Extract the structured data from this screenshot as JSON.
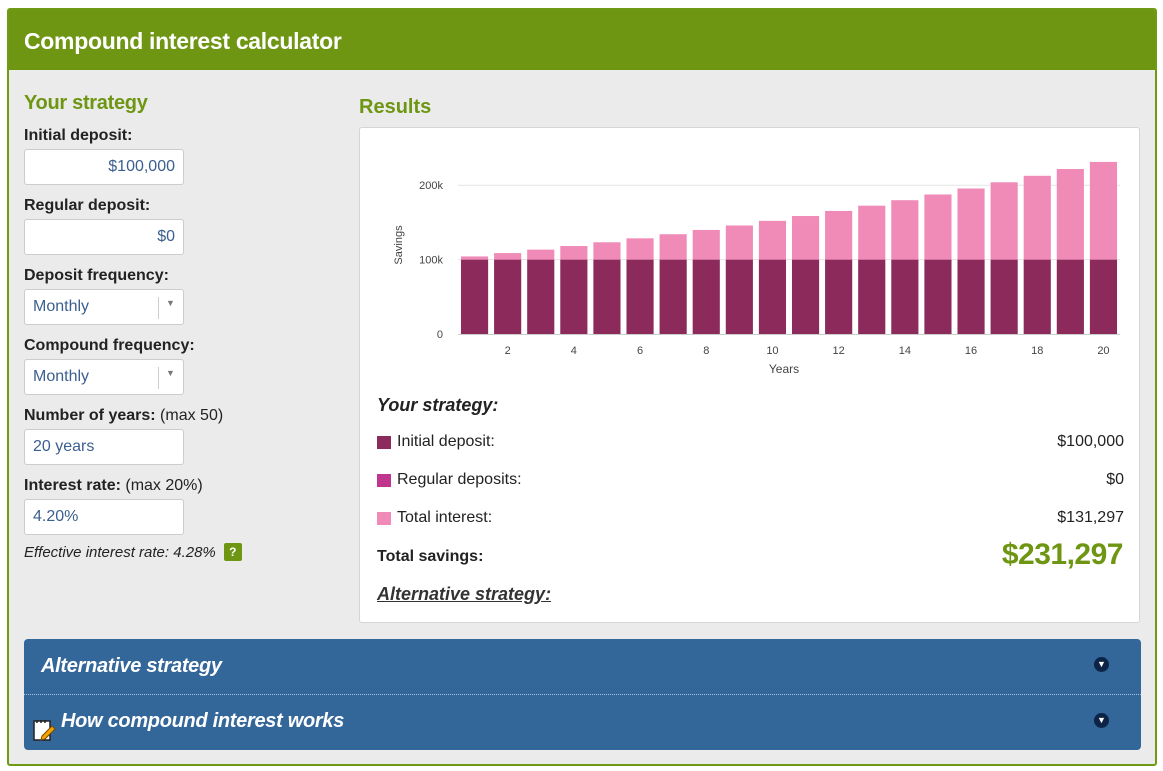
{
  "app": {
    "title": "Compound interest calculator"
  },
  "strategy": {
    "title": "Your strategy",
    "initial_deposit": {
      "label": "Initial deposit:",
      "value": "$100,000"
    },
    "regular_deposit": {
      "label": "Regular deposit:",
      "value": "$0"
    },
    "deposit_frequency": {
      "label": "Deposit frequency:",
      "value": "Monthly"
    },
    "compound_frequency": {
      "label": "Compound frequency:",
      "value": "Monthly"
    },
    "years": {
      "label": "Number of years:",
      "hint": "(max 50)",
      "value": "20 years"
    },
    "interest_rate": {
      "label": "Interest rate:",
      "hint": "(max 20%)",
      "value": "4.20%"
    },
    "effective_rate": "Effective interest rate: 4.28%",
    "help_label": "?"
  },
  "results": {
    "title": "Results",
    "summary_heading": "Your strategy:",
    "rows": [
      {
        "label": "Initial deposit:",
        "value": "$100,000",
        "color": "#8b2a5b"
      },
      {
        "label": "Regular deposits:",
        "value": "$0",
        "color": "#c0368f"
      },
      {
        "label": "Total interest:",
        "value": "$131,297",
        "color": "#f08bb8"
      }
    ],
    "total_label": "Total savings:",
    "total_value": "$231,297",
    "alternative_link": "Alternative strategy:"
  },
  "chart_data": {
    "type": "bar",
    "stacked": true,
    "x": [
      1,
      2,
      3,
      4,
      5,
      6,
      7,
      8,
      9,
      10,
      11,
      12,
      13,
      14,
      15,
      16,
      17,
      18,
      19,
      20
    ],
    "x_ticks": [
      "2",
      "4",
      "6",
      "8",
      "10",
      "12",
      "14",
      "16",
      "18",
      "20"
    ],
    "xlabel": "Years",
    "ylabel": "Savings",
    "y_ticks": [
      "0",
      "100k",
      "200k"
    ],
    "ylim": [
      0,
      200000
    ],
    "grid": true,
    "series": [
      {
        "name": "Initial deposit",
        "color": "#8b2a5b",
        "values": [
          100000,
          100000,
          100000,
          100000,
          100000,
          100000,
          100000,
          100000,
          100000,
          100000,
          100000,
          100000,
          100000,
          100000,
          100000,
          100000,
          100000,
          100000,
          100000,
          100000
        ]
      },
      {
        "name": "Regular deposits",
        "color": "#c0368f",
        "values": [
          0,
          0,
          0,
          0,
          0,
          0,
          0,
          0,
          0,
          0,
          0,
          0,
          0,
          0,
          0,
          0,
          0,
          0,
          0,
          0
        ]
      },
      {
        "name": "Total interest",
        "color": "#f08bb8",
        "values": [
          4283,
          8749,
          13405,
          18261,
          23324,
          28604,
          34110,
          39850,
          45836,
          52078,
          58587,
          65375,
          72452,
          79833,
          87529,
          95555,
          103923,
          112650,
          121750,
          131297
        ]
      }
    ]
  },
  "accordion": [
    {
      "title": "Alternative strategy",
      "icon": "chevron-down-icon"
    },
    {
      "title": "How compound interest works",
      "icon": "notepad-pencil-icon"
    }
  ]
}
